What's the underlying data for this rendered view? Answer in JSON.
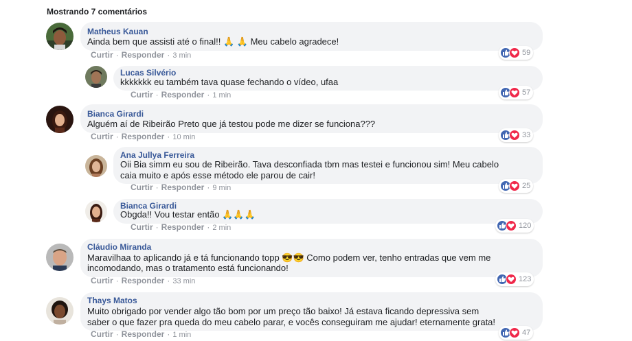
{
  "header": {
    "title": "Mostrando 7 comentários"
  },
  "actions": {
    "like": "Curtir",
    "reply": "Responder",
    "sep": "·"
  },
  "colors": {
    "name": "#385898",
    "bubble": "#f2f3f5",
    "like": "#4267b2",
    "love": "#f0284a"
  },
  "comments": [
    {
      "name": "Matheus Kauan",
      "lines": [
        "Ainda bem que assisti até o final!! 🙏 🙏 Meu cabelo agradece!"
      ],
      "time": "3 min",
      "reactions": "59"
    },
    {
      "name": "Lucas Silvério",
      "lines": [
        "kkkkkkk eu também tava quase fechando o vídeo, ufaa"
      ],
      "time": "1 min",
      "reactions": "57"
    },
    {
      "name": "Bianca Girardi",
      "lines": [
        "Alguém aí de Ribeirão Preto que já testou pode me dizer se funciona???"
      ],
      "time": "10 min",
      "reactions": "33"
    },
    {
      "name": "Ana Jullya Ferreira",
      "lines": [
        "Oii Bia simm eu sou de Ribeirão. Tava desconfiada tbm mas testei e funcionou sim! Meu cabelo",
        "caia muito e após esse método ele parou de cair!"
      ],
      "time": "9 min",
      "reactions": "25"
    },
    {
      "name": "Bianca Girardi",
      "lines": [
        "Obgda!! Vou testar então 🙏🙏🙏"
      ],
      "time": "2 min",
      "reactions": "120"
    },
    {
      "name": "Cláudio Miranda",
      "lines": [
        "Maravilhaa to aplicando já e tá funcionando topp 😎😎 Como podem ver, tenho entradas que vem me",
        "incomodando, mas o tratamento está funcionando!"
      ],
      "time": "33 min",
      "reactions": "123"
    },
    {
      "name": "Thays Matos",
      "lines": [
        "Muito obrigado por vender algo tão bom por um preço tão baixo! Já estava ficando depressiva sem",
        "saber o que fazer pra queda do meu cabelo parar, e vocês conseguiram me ajudar! eternamente grata!"
      ],
      "time": "1 min",
      "reactions": "47"
    }
  ]
}
